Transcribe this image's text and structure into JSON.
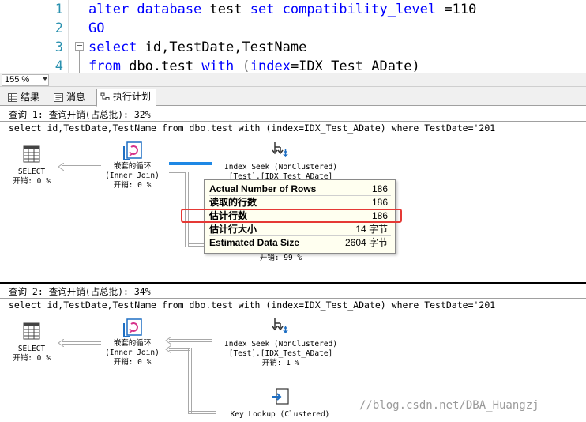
{
  "editor": {
    "line_numbers": [
      "1",
      "2",
      "3",
      "4"
    ],
    "line1": {
      "kw1": "alter database",
      "plain1": " test ",
      "kw2": "set compatibility_level",
      "plain2": " =110"
    },
    "line2": {
      "kw1": "GO"
    },
    "line3": {
      "kw1": "select",
      "plain1": " id,TestDate,TestName"
    },
    "line4": {
      "kw1": "from",
      "plain1": " dbo.test ",
      "kw2": "with",
      "gray1": " (",
      "kw3": "index",
      "plain2": "=IDX_Test_ADate)"
    }
  },
  "zoom": {
    "value": "155 %"
  },
  "tabs": [
    {
      "label": "结果",
      "icon": "grid-icon"
    },
    {
      "label": "消息",
      "icon": "message-icon"
    },
    {
      "label": "执行计划",
      "icon": "plan-icon",
      "active": true
    }
  ],
  "query1": {
    "header": "查询 1: 查询开销(占总批): 32%",
    "sql": "select id,TestDate,TestName from dbo.test with (index=IDX_Test_ADate) where TestDate='201",
    "select_node": {
      "line1": "SELECT",
      "line2": "开销: 0 %"
    },
    "loop_node": {
      "line1": "嵌套的循环",
      "line2": "(Inner Join)",
      "line3": "开销: 0 %"
    },
    "seek_node": {
      "line1": "Index Seek (NonClustered)",
      "line2": "[Test].[IDX_Test_ADate]"
    },
    "lookup_cost": "开销: 99 %"
  },
  "tooltip": {
    "rows": [
      {
        "key": "Actual Number of Rows",
        "value": "186"
      },
      {
        "key": "读取的行数",
        "value": "186"
      },
      {
        "key": "估计行数",
        "value": "186"
      },
      {
        "key": "估计行大小",
        "value": "14 字节"
      },
      {
        "key": "Estimated Data Size",
        "value": "2604 字节"
      }
    ]
  },
  "query2": {
    "header": "查询 2: 查询开销(占总批): 34%",
    "sql": "select id,TestDate,TestName from dbo.test with (index=IDX_Test_ADate) where TestDate='201",
    "select_node": {
      "line1": "SELECT",
      "line2": "开销: 0 %"
    },
    "loop_node": {
      "line1": "嵌套的循环",
      "line2": "(Inner Join)",
      "line3": "开销: 0 %"
    },
    "seek_node": {
      "line1": "Index Seek (NonClustered)",
      "line2": "[Test].[IDX_Test_ADate]",
      "line3": "开销: 1 %"
    },
    "lookup_node": {
      "line1": "Key Lookup (Clustered)"
    }
  },
  "watermark": "//blog.csdn.net/DBA_Huangzj",
  "colors": {
    "keyword": "#0000ff",
    "line_number": "#2b91af",
    "highlight": "#e53935",
    "tooltip_bg": "#fffff0",
    "active_arrow": "#1e88e5",
    "icon_blue": "#1e6fc4",
    "icon_pink": "#d6338a"
  }
}
